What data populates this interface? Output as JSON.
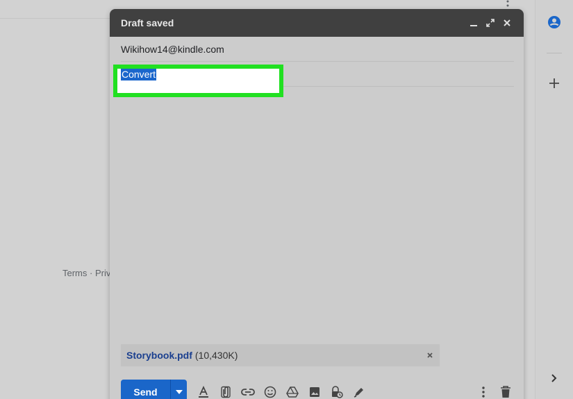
{
  "compose": {
    "title": "Draft saved",
    "to": "Wikihow14@kindle.com",
    "subject": "Convert",
    "attachment": {
      "name": "Storybook.pdf",
      "size": "(10,430K)"
    },
    "send_label": "Send"
  },
  "footer": {
    "links": "Terms · Priva"
  },
  "colors": {
    "highlight": "#21e021",
    "send": "#1a66c9",
    "selection": "#1a66cc",
    "header": "#404040"
  },
  "icons": {
    "header": [
      "minimize-icon",
      "expand-icon",
      "close-icon"
    ],
    "toolbar": [
      "format-text-icon",
      "attach-icon",
      "link-icon",
      "emoji-icon",
      "drive-icon",
      "photo-icon",
      "confidential-icon",
      "signature-icon",
      "more-options-icon",
      "trash-icon"
    ],
    "side": [
      "contacts-icon",
      "add-icon",
      "chevron-right-icon"
    ]
  }
}
